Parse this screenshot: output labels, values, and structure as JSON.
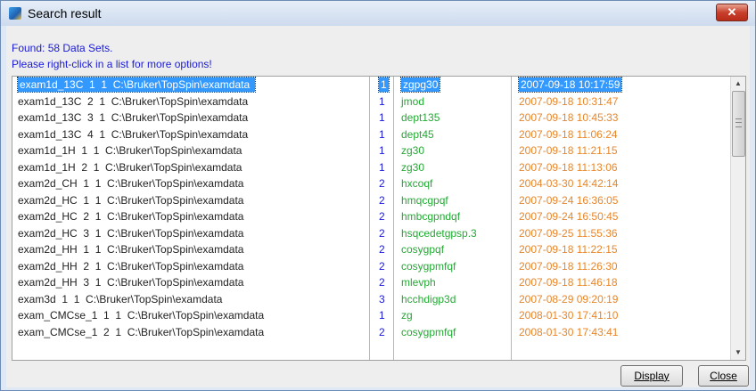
{
  "window": {
    "title": "Search result",
    "close_glyph": "✕"
  },
  "info": {
    "found": "Found: 58 Data Sets.",
    "hint": "Please right-click in a list for more options!"
  },
  "rows": [
    {
      "name": "exam1d_13C  1  1  C:\\Bruker\\TopSpin\\examdata",
      "proc": "1",
      "program": "zgpg30",
      "date": "2007-09-18 10:17:59"
    },
    {
      "name": "exam1d_13C  2  1  C:\\Bruker\\TopSpin\\examdata",
      "proc": "1",
      "program": "jmod",
      "date": "2007-09-18 10:31:47"
    },
    {
      "name": "exam1d_13C  3  1  C:\\Bruker\\TopSpin\\examdata",
      "proc": "1",
      "program": "dept135",
      "date": "2007-09-18 10:45:33"
    },
    {
      "name": "exam1d_13C  4  1  C:\\Bruker\\TopSpin\\examdata",
      "proc": "1",
      "program": "dept45",
      "date": "2007-09-18 11:06:24"
    },
    {
      "name": "exam1d_1H  1  1  C:\\Bruker\\TopSpin\\examdata",
      "proc": "1",
      "program": "zg30",
      "date": "2007-09-18 11:21:15"
    },
    {
      "name": "exam1d_1H  2  1  C:\\Bruker\\TopSpin\\examdata",
      "proc": "1",
      "program": "zg30",
      "date": "2007-09-18 11:13:06"
    },
    {
      "name": "exam2d_CH  1  1  C:\\Bruker\\TopSpin\\examdata",
      "proc": "2",
      "program": "hxcoqf",
      "date": "2004-03-30 14:42:14"
    },
    {
      "name": "exam2d_HC  1  1  C:\\Bruker\\TopSpin\\examdata",
      "proc": "2",
      "program": "hmqcgpqf",
      "date": "2007-09-24 16:36:05"
    },
    {
      "name": "exam2d_HC  2  1  C:\\Bruker\\TopSpin\\examdata",
      "proc": "2",
      "program": "hmbcgpndqf",
      "date": "2007-09-24 16:50:45"
    },
    {
      "name": "exam2d_HC  3  1  C:\\Bruker\\TopSpin\\examdata",
      "proc": "2",
      "program": "hsqcedetgpsp.3",
      "date": "2007-09-25 11:55:36"
    },
    {
      "name": "exam2d_HH  1  1  C:\\Bruker\\TopSpin\\examdata",
      "proc": "2",
      "program": "cosygpqf",
      "date": "2007-09-18 11:22:15"
    },
    {
      "name": "exam2d_HH  2  1  C:\\Bruker\\TopSpin\\examdata",
      "proc": "2",
      "program": "cosygpmfqf",
      "date": "2007-09-18 11:26:30"
    },
    {
      "name": "exam2d_HH  3  1  C:\\Bruker\\TopSpin\\examdata",
      "proc": "2",
      "program": "mlevph",
      "date": "2007-09-18 11:46:18"
    },
    {
      "name": "exam3d  1  1  C:\\Bruker\\TopSpin\\examdata",
      "proc": "3",
      "program": "hcchdigp3d",
      "date": "2007-08-29 09:20:19"
    },
    {
      "name": "exam_CMCse_1  1  1  C:\\Bruker\\TopSpin\\examdata",
      "proc": "1",
      "program": "zg",
      "date": "2008-01-30 17:41:10"
    },
    {
      "name": "exam_CMCse_1  2  1  C:\\Bruker\\TopSpin\\examdata",
      "proc": "2",
      "program": "cosygpmfqf",
      "date": "2008-01-30 17:43:41"
    }
  ],
  "selected_row": 0,
  "buttons": {
    "display": "Display",
    "close": "Close"
  },
  "colors": {
    "info_text": "#1a1ad8",
    "program_text": "#22aa33",
    "date_text": "#e8862a",
    "selection": "#3399ff"
  },
  "icons": {
    "app": "topspin-app-icon",
    "scroll_up": "scroll-up-arrow-icon",
    "scroll_down": "scroll-down-arrow-icon"
  }
}
